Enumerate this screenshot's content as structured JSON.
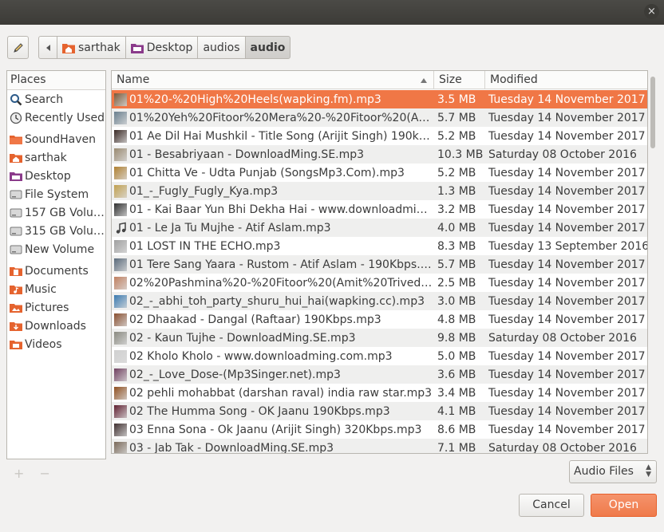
{
  "window": {
    "close_glyph": "×"
  },
  "path_bar": {
    "items": [
      {
        "label": "sarthak",
        "icon": "home-folder-icon"
      },
      {
        "label": "Desktop",
        "icon": "desktop-folder-icon"
      },
      {
        "label": "audios"
      },
      {
        "label": "audio",
        "active": true
      }
    ]
  },
  "places": {
    "header": "Places",
    "items": [
      {
        "label": "Search",
        "icon": "search-icon"
      },
      {
        "label": "Recently Used",
        "icon": "clock-icon"
      },
      {
        "label": "SoundHaven",
        "icon": "folder-icon"
      },
      {
        "label": "sarthak",
        "icon": "home-folder-icon"
      },
      {
        "label": "Desktop",
        "icon": "desktop-folder-icon"
      },
      {
        "label": "File System",
        "icon": "drive-icon"
      },
      {
        "label": "157 GB Volu…",
        "icon": "drive-icon"
      },
      {
        "label": "315 GB Volu…",
        "icon": "drive-icon"
      },
      {
        "label": "New Volume",
        "icon": "drive-icon"
      },
      {
        "label": "Documents",
        "icon": "documents-folder-icon"
      },
      {
        "label": "Music",
        "icon": "music-folder-icon"
      },
      {
        "label": "Pictures",
        "icon": "pictures-folder-icon"
      },
      {
        "label": "Downloads",
        "icon": "downloads-folder-icon"
      },
      {
        "label": "Videos",
        "icon": "videos-folder-icon"
      }
    ]
  },
  "file_list": {
    "columns": {
      "name": "Name",
      "size": "Size",
      "modified": "Modified"
    },
    "rows": [
      {
        "name": "01%20-%20High%20Heels(wapking.fm).mp3",
        "size": "3.5 MB",
        "modified": "Tuesday 14 November 2017",
        "selected": true,
        "thumb": "#7a5a3a"
      },
      {
        "name": "01%20Yeh%20Fitoor%20Mera%20-%20Fitoor%20(Ari…",
        "size": "5.7 MB",
        "modified": "Tuesday 14 November 2017",
        "thumb": "#6a7f8e"
      },
      {
        "name": "01 Ae Dil Hai Mushkil - Title Song (Arijit Singh) 190kbps…",
        "size": "5.2 MB",
        "modified": "Tuesday 14 November 2017",
        "thumb": "#3b2a25"
      },
      {
        "name": "01 - Besabriyaan - DownloadMing.SE.mp3",
        "size": "10.3 MB",
        "modified": "Saturday 08 October 2016",
        "thumb": "#9a8a70"
      },
      {
        "name": "01 Chitta Ve - Udta Punjab (SongsMp3.Com).mp3",
        "size": "5.2 MB",
        "modified": "Tuesday 14 November 2017",
        "thumb": "#b08030"
      },
      {
        "name": "01_-_Fugly_Fugly_Kya.mp3",
        "size": "1.3 MB",
        "modified": "Tuesday 14 November 2017",
        "thumb": "#c0a050"
      },
      {
        "name": "01 - Kai Baar Yun Bhi Dekha Hai - www.downloadming.c…",
        "size": "3.2 MB",
        "modified": "Tuesday 14 November 2017",
        "thumb": "#303030"
      },
      {
        "name": "01 - Le Ja Tu Mujhe - Atif Aslam.mp3",
        "size": "4.0 MB",
        "modified": "Tuesday 14 November 2017",
        "thumb": "music-note"
      },
      {
        "name": "01 LOST IN THE ECHO.mp3",
        "size": "8.3 MB",
        "modified": "Tuesday 13 September 2016",
        "thumb": "#a0a0a0"
      },
      {
        "name": "01 Tere Sang Yaara - Rustom - Atif Aslam - 190Kbps.mp3",
        "size": "5.7 MB",
        "modified": "Tuesday 14 November 2017",
        "thumb": "#5a6a7a"
      },
      {
        "name": "02%20Pashmina%20-%20Fitoor%20(Amit%20Trivedi)…",
        "size": "2.5 MB",
        "modified": "Tuesday 14 November 2017",
        "thumb": "#c08060"
      },
      {
        "name": "02_-_abhi_toh_party_shuru_hui_hai(wapking.cc).mp3",
        "size": "3.0 MB",
        "modified": "Tuesday 14 November 2017",
        "thumb": "#3a7ab0"
      },
      {
        "name": "02 Dhaakad - Dangal (Raftaar) 190Kbps.mp3",
        "size": "4.8 MB",
        "modified": "Tuesday 14 November 2017",
        "thumb": "#8a5030"
      },
      {
        "name": "02 - Kaun Tujhe - DownloadMing.SE.mp3",
        "size": "9.8 MB",
        "modified": "Saturday 08 October 2016",
        "thumb": "#8a8a80"
      },
      {
        "name": "02 Kholo Kholo - www.downloadming.com.mp3",
        "size": "5.0 MB",
        "modified": "Tuesday 14 November 2017",
        "thumb": "#d0d0d0"
      },
      {
        "name": "02_-_Love_Dose-(Mp3Singer.net).mp3",
        "size": "3.6 MB",
        "modified": "Tuesday 14 November 2017",
        "thumb": "#704060"
      },
      {
        "name": "02 pehli mohabbat (darshan raval) india raw star.mp3",
        "size": "3.4 MB",
        "modified": "Tuesday 14 November 2017",
        "thumb": "#905020"
      },
      {
        "name": "02 The Humma Song - OK Jaanu 190Kbps.mp3",
        "size": "4.1 MB",
        "modified": "Tuesday 14 November 2017",
        "thumb": "#602030"
      },
      {
        "name": "03 Enna Sona - Ok Jaanu (Arijit Singh) 320Kbps.mp3",
        "size": "8.6 MB",
        "modified": "Tuesday 14 November 2017",
        "thumb": "#403030"
      },
      {
        "name": "03 - Jab Tak - DownloadMing.SE.mp3",
        "size": "7.1 MB",
        "modified": "Saturday 08 October 2016",
        "thumb": "#7a6a5a"
      }
    ]
  },
  "sidebar_buttons": {
    "add": "+",
    "remove": "−"
  },
  "filter": {
    "selected": "Audio Files"
  },
  "actions": {
    "cancel": "Cancel",
    "open": "Open"
  },
  "colors": {
    "accent": "#f07746",
    "titlebar": "#3c3b37"
  }
}
